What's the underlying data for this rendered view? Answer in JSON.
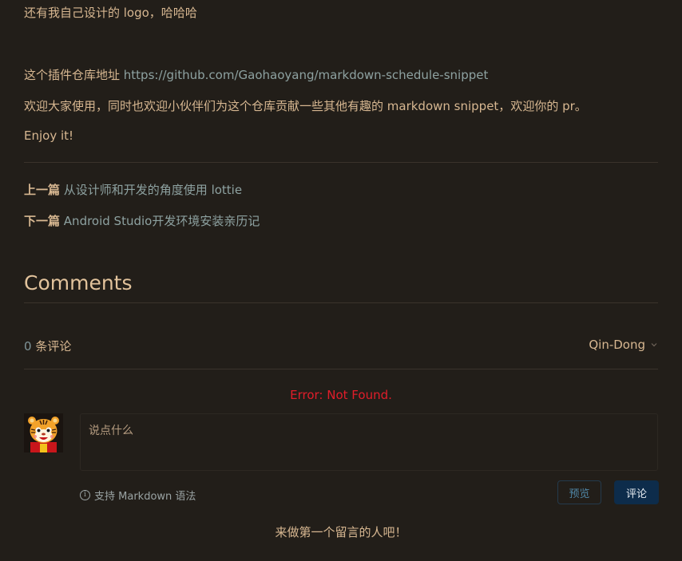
{
  "article": {
    "line1": "还有我自己设计的 logo，哈哈哈",
    "repo_prefix": "这个插件仓库地址 ",
    "repo_link": "https://github.com/Gaohaoyang/markdown-schedule-snippet",
    "welcome": "欢迎大家使用，同时也欢迎小伙伴们为这个仓库贡献一些其他有趣的 markdown snippet，欢迎你的 pr。",
    "enjoy": "Enjoy it!"
  },
  "post_nav": {
    "prev_label": "上一篇",
    "prev_title": "从设计师和开发的角度使用 lottie",
    "next_label": "下一篇",
    "next_title": "Android Studio开发环境安装亲历记"
  },
  "comments": {
    "heading": "Comments",
    "count": "0",
    "count_suffix": " 条评论",
    "user": "Qin-Dong",
    "error": "Error: Not Found.",
    "placeholder": "说点什么",
    "markdown_hint": "支持 Markdown 语法",
    "info_icon_glyph": "i",
    "preview_label": "预览",
    "submit_label": "评论",
    "empty_message": "来做第一个留言的人吧！"
  },
  "colors": {
    "background": "#221e19",
    "text": "#d7b791",
    "link": "#8ea2a1",
    "error": "#e11d2a",
    "submit_bg": "#0d2c4b"
  },
  "icons": {
    "avatar": "tiger-avatar",
    "dropdown": "chevron-down-icon",
    "info": "info-icon"
  }
}
